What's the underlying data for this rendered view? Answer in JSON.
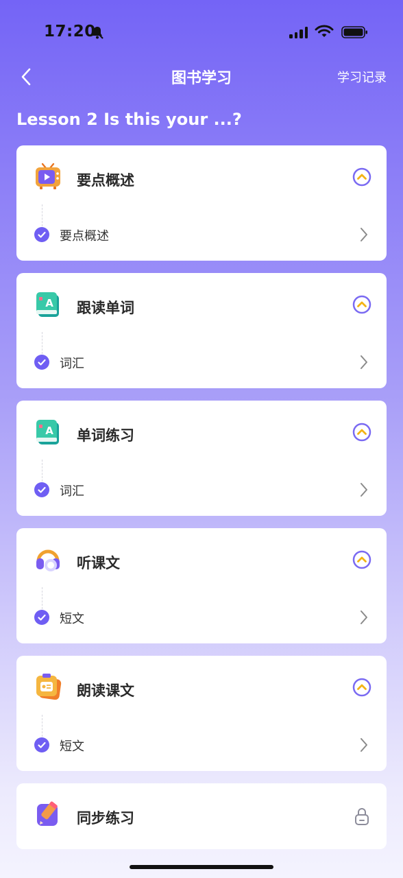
{
  "status": {
    "time": "17:20"
  },
  "nav": {
    "title": "图书学习",
    "right_label": "学习记录"
  },
  "lesson_title": "Lesson 2 Is this your ...?",
  "cards": [
    {
      "title": "要点概述",
      "icon": "tv-icon",
      "item": "要点概述",
      "state": "expanded"
    },
    {
      "title": "跟读单词",
      "icon": "word-book-icon",
      "item": "词汇",
      "state": "expanded"
    },
    {
      "title": "单词练习",
      "icon": "word-book-icon",
      "item": "词汇",
      "state": "expanded"
    },
    {
      "title": "听课文",
      "icon": "headphones-icon",
      "item": "短文",
      "state": "expanded"
    },
    {
      "title": "朗读课文",
      "icon": "reading-icon",
      "item": "短文",
      "state": "expanded"
    },
    {
      "title": "同步练习",
      "icon": "pencil-icon",
      "state": "locked"
    }
  ],
  "colors": {
    "accent": "#6f5ef3",
    "toggle_ring": "#7a6af2",
    "toggle_arrow": "#f3b415"
  }
}
